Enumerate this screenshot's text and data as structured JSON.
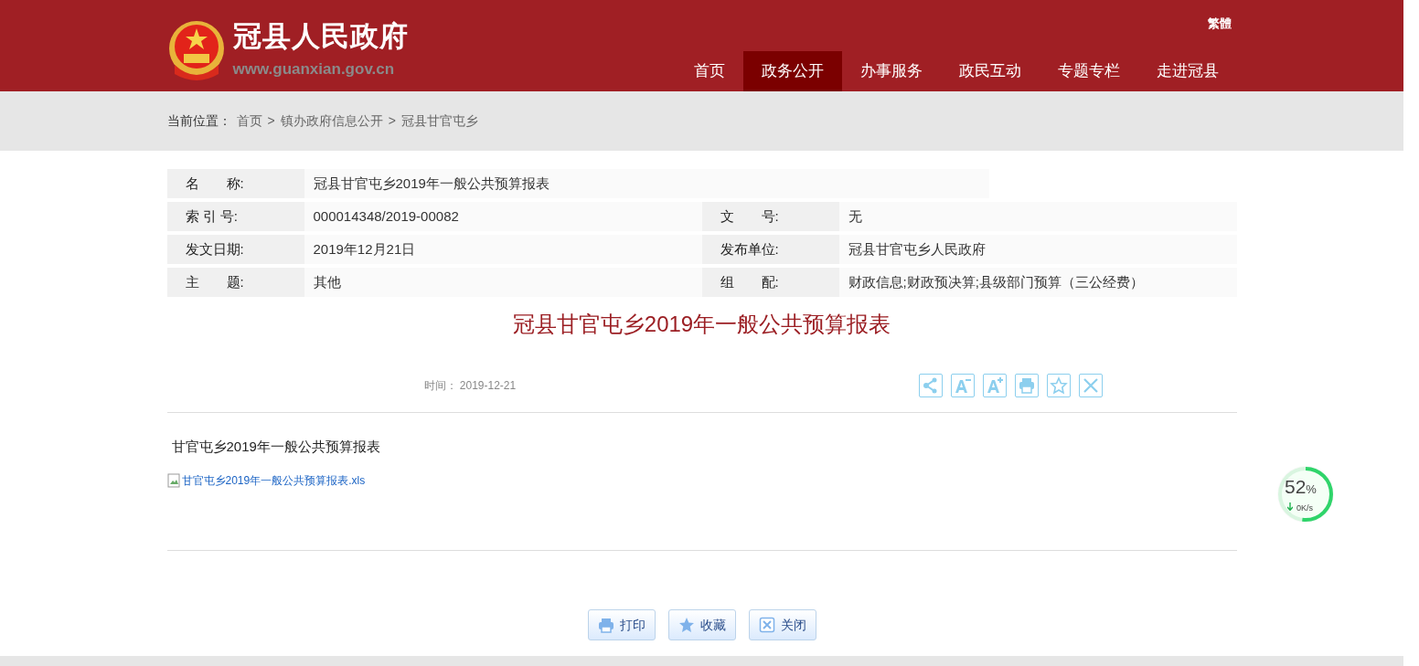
{
  "header": {
    "site_title": "冠县人民政府",
    "site_url": "www.guanxian.gov.cn",
    "language_link": "繁體",
    "nav": [
      {
        "label": "首页",
        "selected": false
      },
      {
        "label": "政务公开",
        "selected": true
      },
      {
        "label": "办事服务",
        "selected": false
      },
      {
        "label": "政民互动",
        "selected": false
      },
      {
        "label": "专题专栏",
        "selected": false
      },
      {
        "label": "走进冠县",
        "selected": false
      }
    ]
  },
  "breadcrumb": {
    "label": "当前位置：",
    "separator": ">",
    "items": [
      "首页",
      "镇办政府信息公开",
      "冠县甘官屯乡"
    ]
  },
  "info_table": {
    "rows": [
      [
        {
          "label": "名　　称:",
          "value": "冠县甘官屯乡2019年一般公共预算报表"
        }
      ],
      [
        {
          "label": "索 引 号:",
          "value": "000014348/2019-00082"
        },
        {
          "label": "文　　号:",
          "value": "无"
        }
      ],
      [
        {
          "label": "发文日期:",
          "value": "2019年12月21日"
        },
        {
          "label": "发布单位:",
          "value": "冠县甘官屯乡人民政府"
        }
      ],
      [
        {
          "label": "主　　题:",
          "value": "其他"
        },
        {
          "label": "组　　配:",
          "value": "财政信息;财政预决算;县级部门预算（三公经费）"
        }
      ]
    ]
  },
  "article": {
    "title": "冠县甘官屯乡2019年一般公共预算报表",
    "time_label": "时间：",
    "time": "2019-12-21",
    "tools": [
      {
        "kind": "share"
      },
      {
        "kind": "font-down"
      },
      {
        "kind": "font-up"
      },
      {
        "kind": "print"
      },
      {
        "kind": "favorite"
      },
      {
        "kind": "close"
      }
    ],
    "body": "甘官屯乡2019年一般公共预算报表",
    "attachment": "甘官屯乡2019年一般公共预算报表.xls"
  },
  "bottom_buttons": [
    {
      "kind": "print",
      "label": "打印"
    },
    {
      "kind": "favorite",
      "label": "收藏"
    },
    {
      "kind": "close",
      "label": "关闭"
    }
  ],
  "speed_widget": {
    "level": 0.52,
    "percent": "52",
    "unit": "%",
    "speed": "0K/s"
  }
}
